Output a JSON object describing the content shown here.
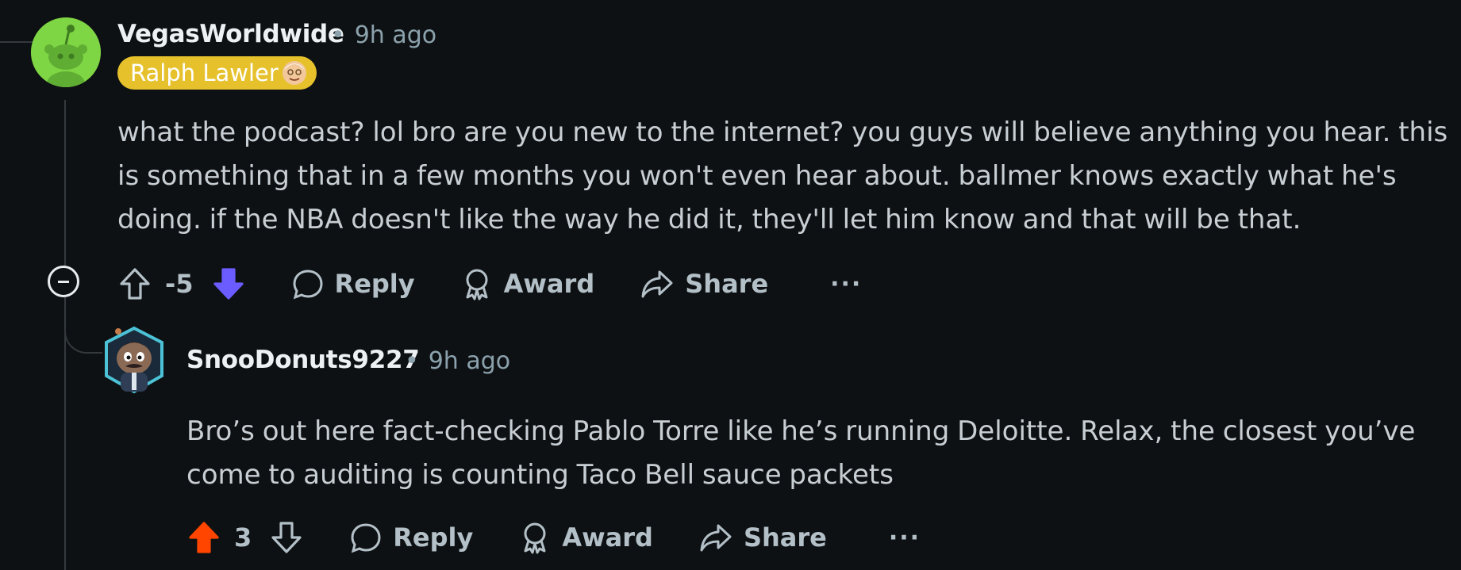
{
  "comments": [
    {
      "author": "VegasWorldwide",
      "separator": "•",
      "time": "9h ago",
      "flair": "Ralph Lawler",
      "body": "what the podcast? lol bro are you new to the internet? you guys will believe anything you hear. this is something that in a few months you won't even hear about. ballmer knows exactly what he's doing. if the NBA doesn't like the way he did it, they'll let him know and that will be that.",
      "score": "-5",
      "vote_state": "downvoted",
      "actions": {
        "reply": "Reply",
        "award": "Award",
        "share": "Share",
        "more": "···"
      }
    },
    {
      "author": "SnooDonuts9227",
      "separator": "•",
      "time": "9h ago",
      "body": "Bro’s out here fact-checking Pablo Torre like he’s running Deloitte. Relax, the closest you’ve come to auditing is counting Taco Bell sauce packets",
      "score": "3",
      "vote_state": "upvoted",
      "actions": {
        "reply": "Reply",
        "award": "Award",
        "share": "Share",
        "more": "···"
      }
    }
  ],
  "colors": {
    "background": "#0e1113",
    "downvote": "#6a5cff",
    "upvote": "#ff4500",
    "flair_bg": "#e6c12c",
    "avatar_green": "#7fd645"
  },
  "icons": {
    "upvote": "upvote-arrow-icon",
    "downvote": "downvote-arrow-icon",
    "reply": "speech-bubble-icon",
    "award": "award-ribbon-icon",
    "share": "share-arrow-icon",
    "collapse": "collapse-minus-icon"
  }
}
